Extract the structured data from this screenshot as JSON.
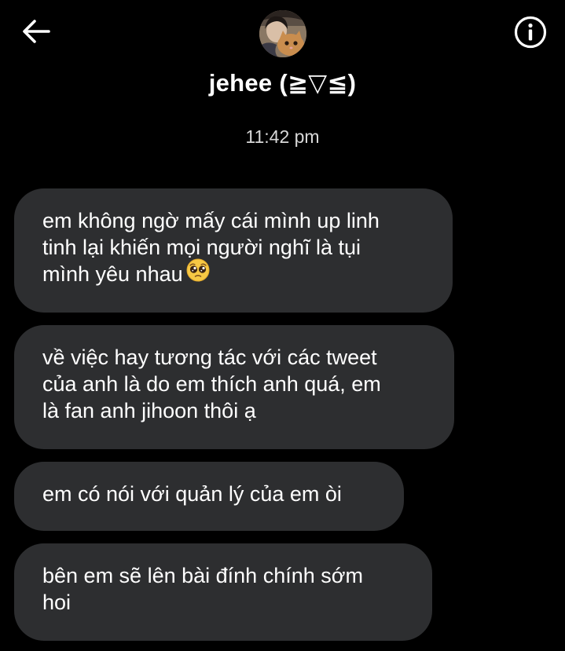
{
  "header": {
    "back_icon": "arrow-left-icon",
    "info_icon": "info-circle-icon",
    "avatar": "profile-photo-avatar",
    "contact_name": "jehee (≧▽≦)"
  },
  "conversation": {
    "timestamp": "11:42 pm",
    "messages": [
      {
        "lines": [
          "em không ngờ mấy cái mình up linh",
          "tinh lại khiến mọi người nghĩ là tụi",
          "mình yêu nhau"
        ],
        "emoji": "pleading-face-emoji"
      },
      {
        "lines": [
          "về việc hay tương tác với các tweet",
          "của anh là do em thích anh quá, em",
          "là fan anh jihoon thôi ạ"
        ]
      },
      {
        "lines": [
          "em có nói với quản lý của em òi"
        ]
      },
      {
        "lines": [
          "bên em sẽ lên bài đính chính sớm",
          "hoi"
        ]
      }
    ]
  },
  "colors": {
    "background": "#000000",
    "bubble": "#2d2e30",
    "text": "#ffffff",
    "timestamp": "#d8d8d8"
  }
}
